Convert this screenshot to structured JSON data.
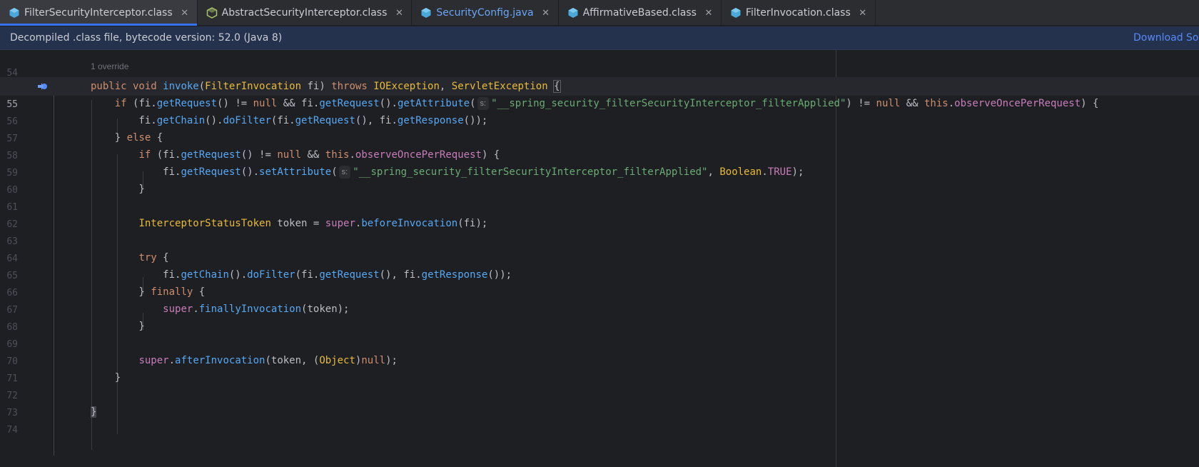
{
  "tabs": [
    {
      "label": "FilterSecurityInterceptor.class",
      "icon": "class-file-icon",
      "active": true
    },
    {
      "label": "AbstractSecurityInterceptor.class",
      "icon": "abstract-class-icon",
      "active": false
    },
    {
      "label": "SecurityConfig.java",
      "icon": "class-file-icon",
      "active": false
    },
    {
      "label": "AffirmativeBased.class",
      "icon": "class-file-icon",
      "active": false
    },
    {
      "label": "FilterInvocation.class",
      "icon": "class-file-icon",
      "active": false
    }
  ],
  "tab_close_glyph": "✕",
  "banner": {
    "text": "Decompiled .class file, bytecode version: 52.0 (Java 8)",
    "link": "Download Sources"
  },
  "editor": {
    "override_hint": "1 override",
    "inlay_hint": "s:",
    "current_line": "55",
    "line_numbers": [
      "54",
      "55",
      "56",
      "57",
      "58",
      "59",
      "60",
      "61",
      "62",
      "63",
      "64",
      "65",
      "66",
      "67",
      "68",
      "69",
      "70",
      "71",
      "72",
      "73",
      "74"
    ]
  },
  "colors": {
    "accent": "#3574f0",
    "keyword": "#cf8e6d",
    "function": "#56a8f5",
    "string": "#6aab73",
    "field": "#c77dbb"
  }
}
